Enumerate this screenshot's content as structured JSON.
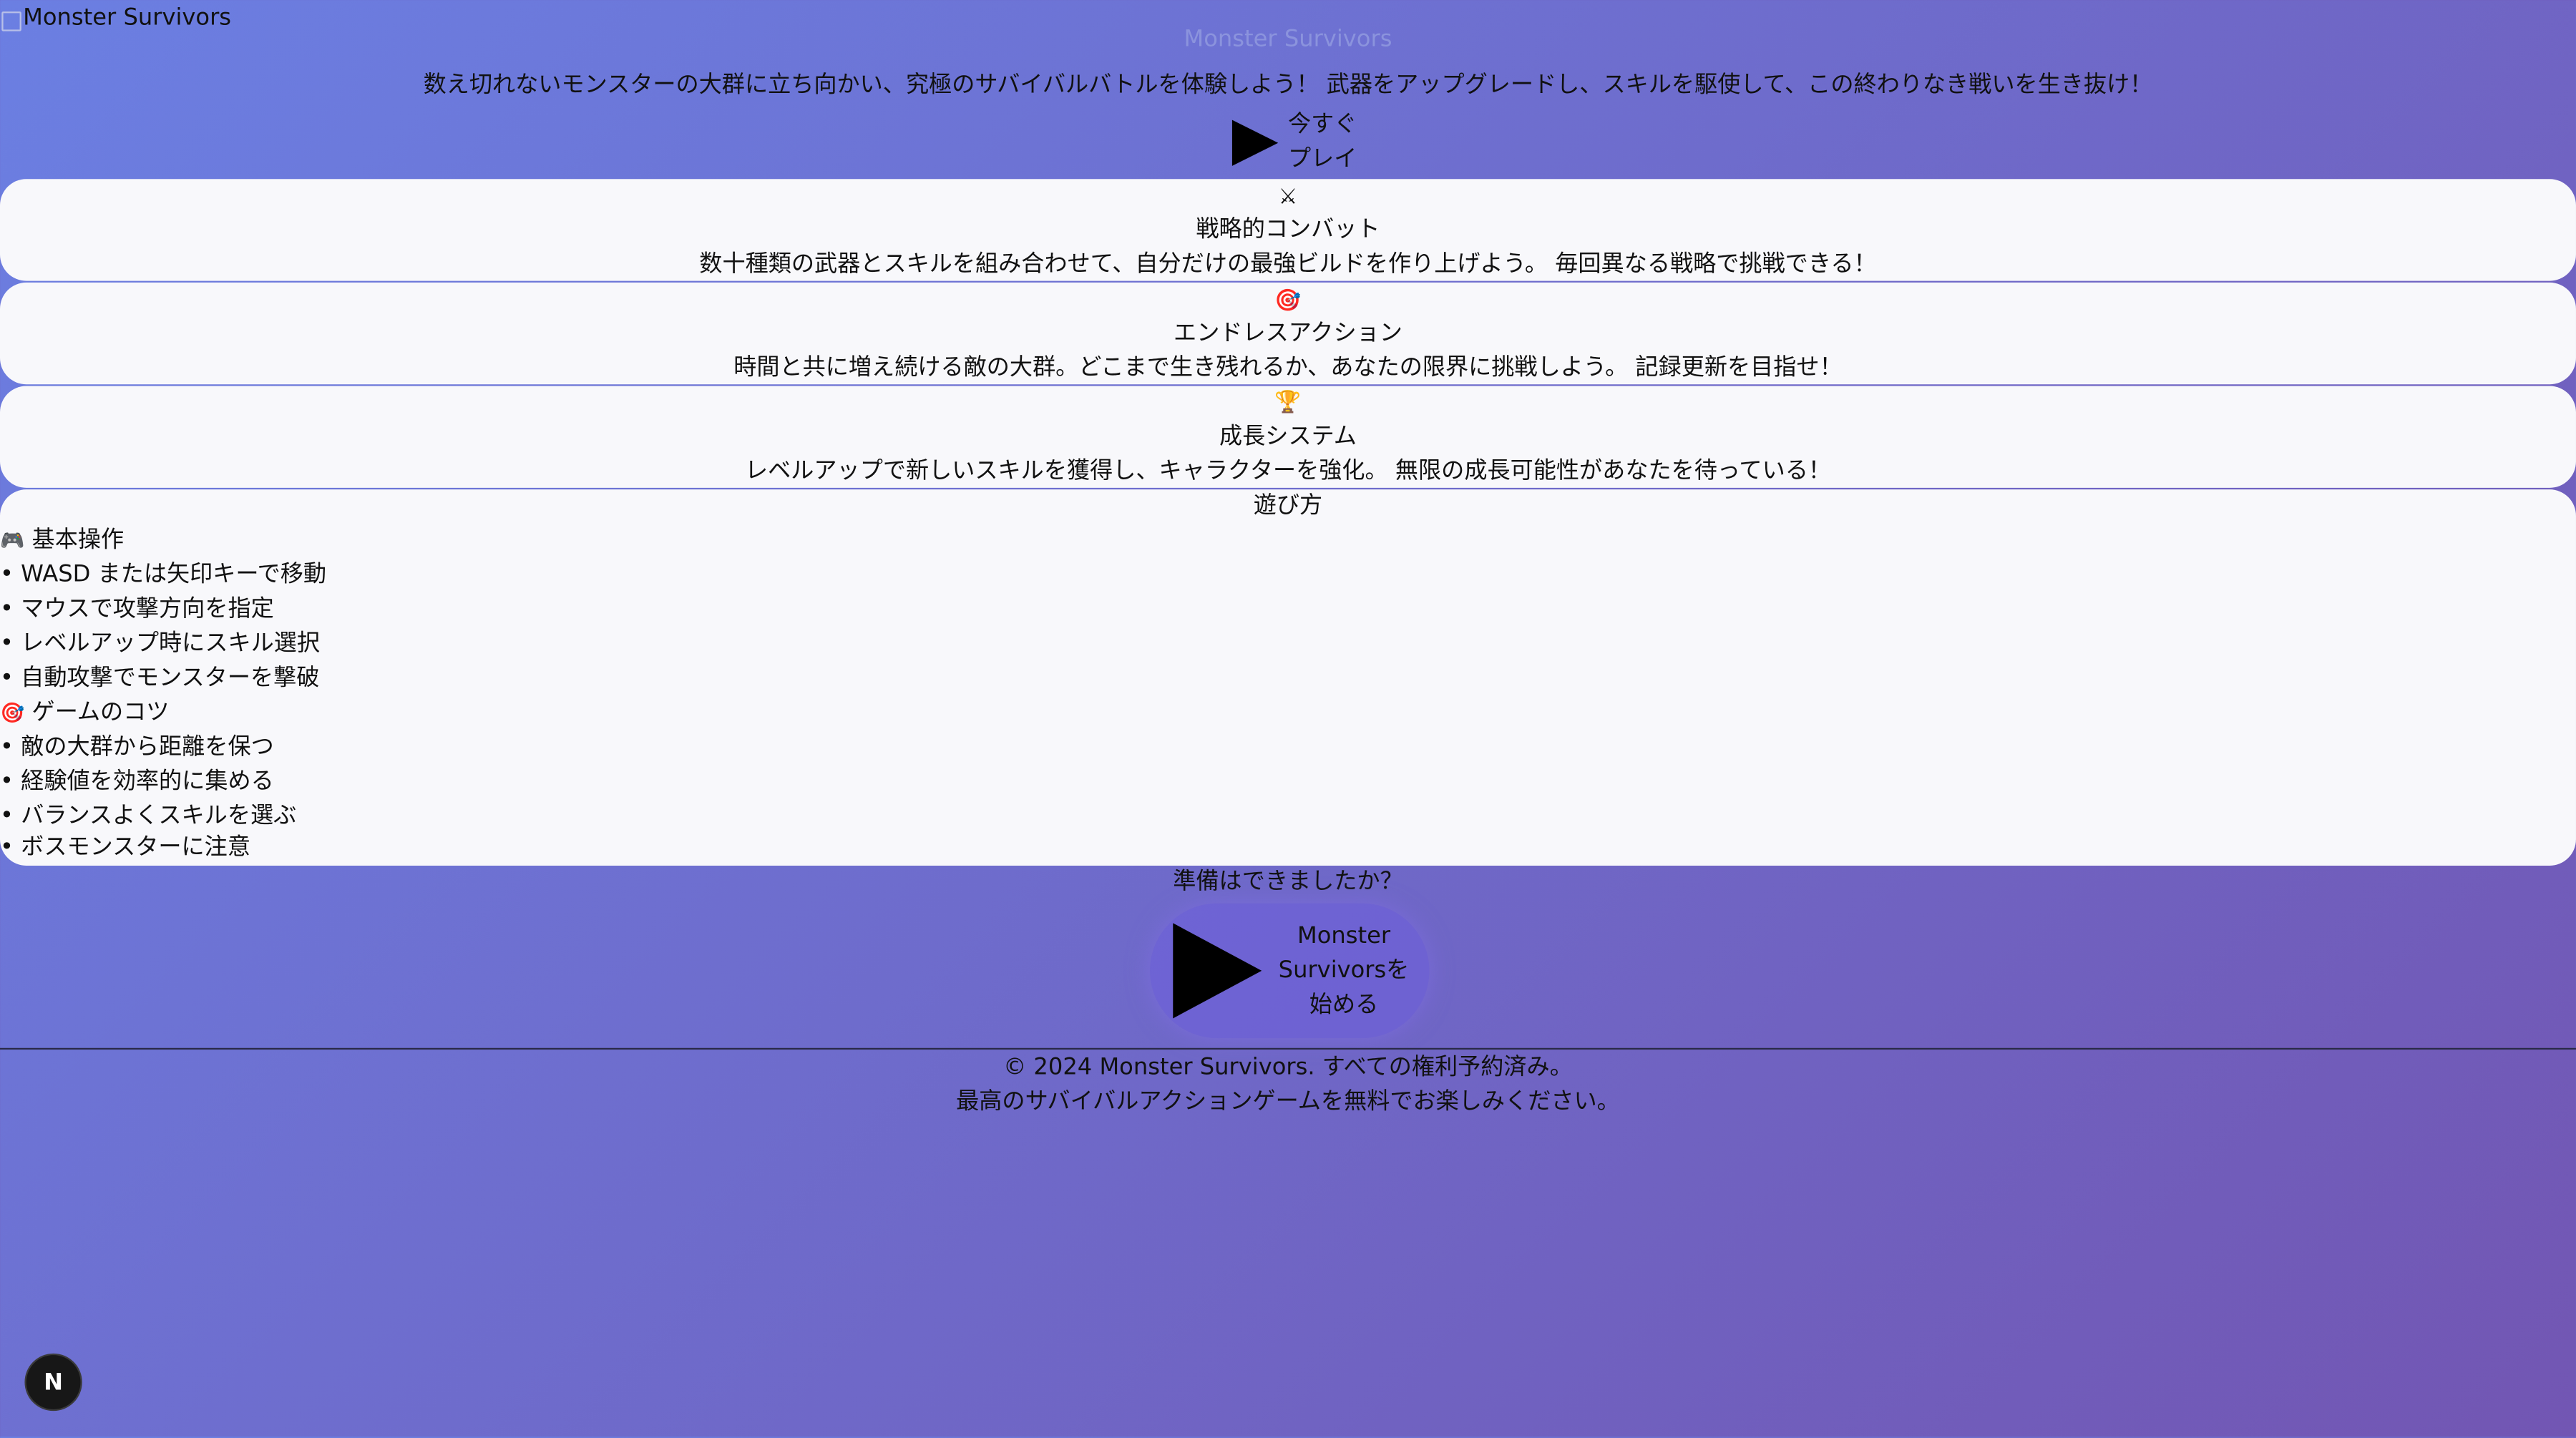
{
  "header": {
    "logo_text": "Monster Survivors"
  },
  "hero": {
    "title": "Monster Survivors",
    "description": "数え切れないモンスターの大群に立ち向かい、究極のサバイバルバトルを体験しよう！ 武器をアップグレードし、スキルを駆使して、この終わりなき戦いを生き抜け！",
    "play_label_1": "今すぐ",
    "play_label_2": "プレイ"
  },
  "features": [
    {
      "icon": "⚔",
      "title": "戦略的コンバット",
      "desc": "数十種類の武器とスキルを組み合わせて、自分だけの最強ビルドを作り上げよう。 毎回異なる戦略で挑戦できる！"
    },
    {
      "icon": "🎯",
      "title": "エンドレスアクション",
      "desc": "時間と共に増え続ける敵の大群。どこまで生き残れるか、あなたの限界に挑戦しよう。 記録更新を目指せ！"
    },
    {
      "icon": "🏆",
      "title": "成長システム",
      "desc": "レベルアップで新しいスキルを獲得し、キャラクターを強化。 無限の成長可能性があなたを待っている！"
    }
  ],
  "howto": {
    "title": "遊び方",
    "basic_icon": "🎮",
    "basic_title": "基本操作",
    "basic_items": [
      "• WASD または矢印キーで移動",
      "• マウスで攻撃方向を指定",
      "• レベルアップ時にスキル選択",
      "• 自動攻撃でモンスターを撃破"
    ],
    "tips_icon": "🎯",
    "tips_title": "ゲームのコツ",
    "tips_items": [
      "• 敵の大群から距離を保つ",
      "• 経験値を効率的に集める",
      "• バランスよくスキルを選ぶ",
      "• ボスモンスターに注意"
    ]
  },
  "cta": {
    "ready_text": "準備はできましたか？",
    "button_line1": "Monster",
    "button_line2": "Survivorsを",
    "button_line3": "始める"
  },
  "footer": {
    "copyright": "© 2024 Monster Survivors. すべての権利予約済み。",
    "tagline": "最高のサバイバルアクションゲームを無料でお楽しみください。"
  },
  "dev_badge": {
    "label": "N"
  },
  "colors": {
    "bg_start": "#6b7fe2",
    "bg_end": "#7256b3",
    "card_bg": "#f8f8fb"
  }
}
